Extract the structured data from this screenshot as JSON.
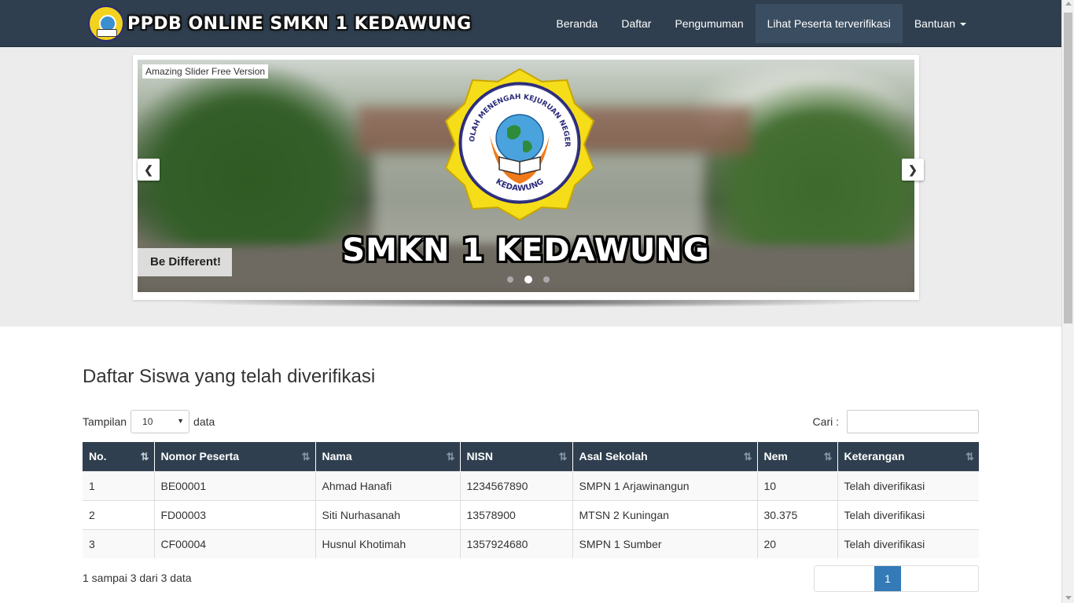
{
  "navbar": {
    "brand": "PPDB ONLINE SMKN 1 KEDAWUNG",
    "items": [
      {
        "label": "Beranda"
      },
      {
        "label": "Daftar"
      },
      {
        "label": "Pengumuman"
      },
      {
        "label": "Lihat Peserta terverifikasi",
        "active": true
      },
      {
        "label": "Bantuan",
        "dropdown": true
      }
    ]
  },
  "slider": {
    "free_label": "Amazing Slider Free Version",
    "title": "SMKN 1 KEDAWUNG",
    "caption": "Be Different!",
    "emblem_text_top": "SEKOLAH MENENGAH KEJURUAN NEGERI 1",
    "emblem_text_bottom": "KEDAWUNG",
    "dots": 3,
    "active_dot": 2
  },
  "main": {
    "title": "Daftar Siswa yang telah diverifikasi",
    "length_label_before": "Tampilan",
    "length_value": "10",
    "length_label_after": "data",
    "search_label": "Cari :",
    "search_value": "",
    "table": {
      "columns": [
        "No.",
        "Nomor Peserta",
        "Nama",
        "NISN",
        "Asal Sekolah",
        "Nem",
        "Keterangan"
      ],
      "rows": [
        [
          "1",
          "BE00001",
          "Ahmad Hanafi",
          "1234567890",
          "SMPN 1 Arjawinangun",
          "10",
          "Telah diverifikasi"
        ],
        [
          "2",
          "FD00003",
          "Siti Nurhasanah",
          "13578900",
          "MTSN 2 Kuningan",
          "30.375",
          "Telah diverifikasi"
        ],
        [
          "3",
          "CF00004",
          "Husnul Khotimah",
          "1357924680",
          "SMPN 1 Sumber",
          "20",
          "Telah diverifikasi"
        ]
      ]
    },
    "info": "1 sampai 3 dari 3 data",
    "pagination": {
      "current": "1"
    }
  },
  "colors": {
    "navbar": "#2f3f4f",
    "accent": "#337ab7"
  }
}
